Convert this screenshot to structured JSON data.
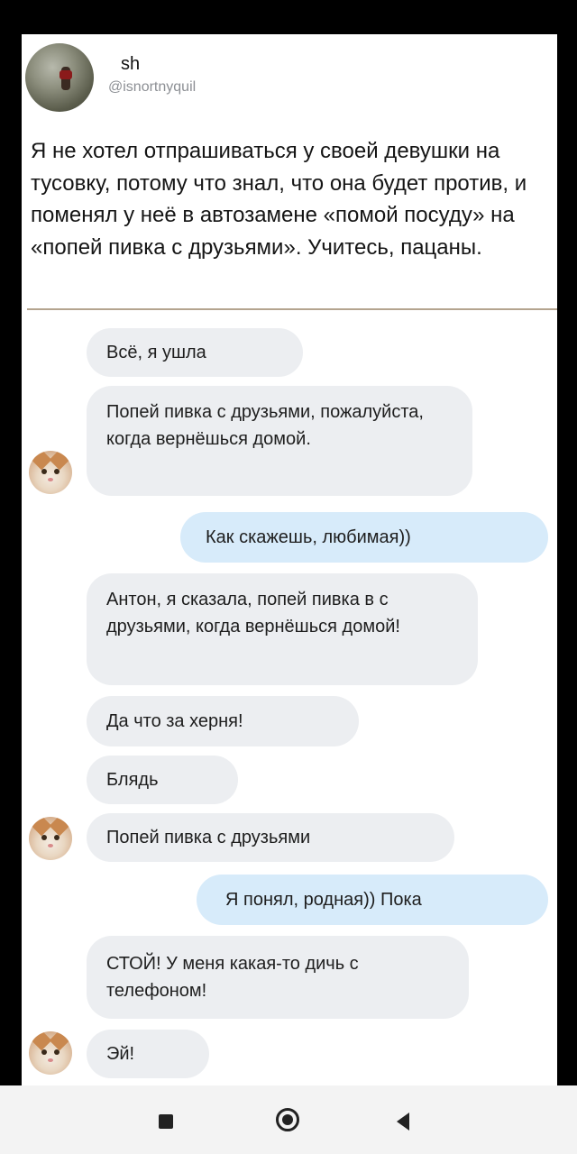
{
  "tweet": {
    "name": "sh",
    "handle": "@isnortnyquil",
    "text": "Я не хотел отпрашиваться у своей девушки на тусовку, потому что знал, что она будет против, и поменял у неё в автозамене «помой посуду» на «попей пивка с друзьями». Учитесь, пацаны."
  },
  "chat": {
    "m1": "Всё, я ушла",
    "m2": "Попей пивка с друзьями, пожалуйста, когда вернёшься домой.",
    "m3": "Как скажешь, любимая))",
    "m4": "Антон, я сказала, попей пивка в с друзьями, когда вернёшься домой!",
    "m5": "Да что за херня!",
    "m6": "Блядь",
    "m7": "Попей пивка с друзьями",
    "m8": "Я понял, родная)) Пока",
    "m9": "СТОЙ! У меня какая-то дичь с телефоном!",
    "m10": "Эй!"
  },
  "colors": {
    "incoming_bubble": "#eceef1",
    "outgoing_bubble": "#d7ebfa",
    "divider": "#b4a48f"
  },
  "navbar": {
    "icons": [
      "recent-apps-icon",
      "home-icon",
      "back-icon"
    ]
  }
}
